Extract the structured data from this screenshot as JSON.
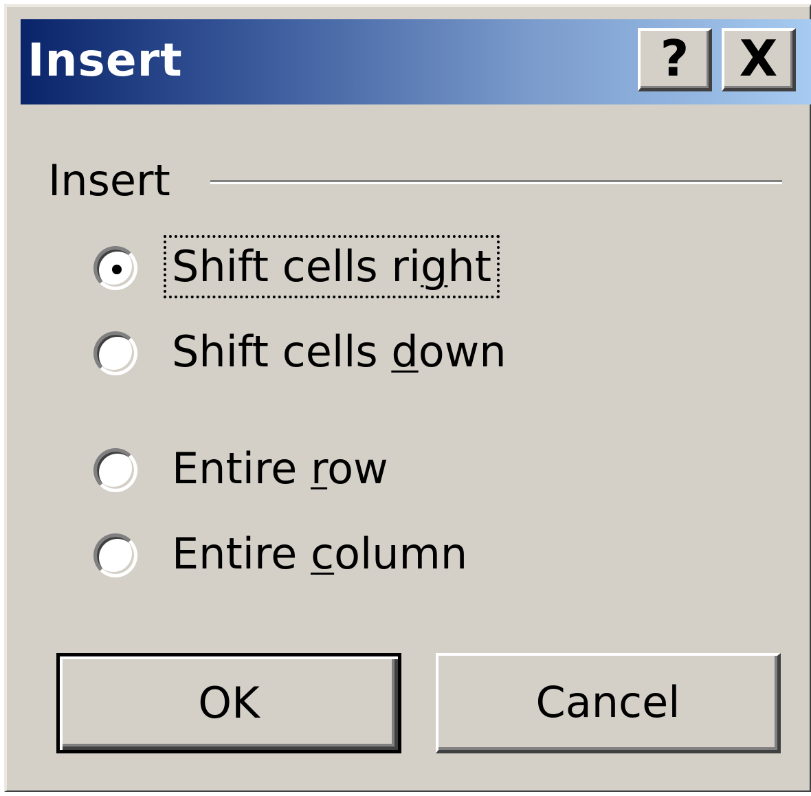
{
  "window": {
    "title": "Insert",
    "help_glyph": "?",
    "close_glyph": "X"
  },
  "group": {
    "label": "Insert"
  },
  "options": [
    {
      "label": "Shift cells right",
      "accelerator": "g",
      "selected": true,
      "focused": true
    },
    {
      "label": "Shift cells down",
      "accelerator": "d",
      "selected": false
    },
    {
      "label": "Entire row",
      "accelerator": "r",
      "selected": false
    },
    {
      "label": "Entire column",
      "accelerator": "c",
      "selected": false
    }
  ],
  "buttons": {
    "ok": "OK",
    "cancel": "Cancel"
  },
  "colors": {
    "titlebar_start": "#0a246a",
    "titlebar_end": "#a6caf0",
    "face": "#d4d0c8"
  }
}
